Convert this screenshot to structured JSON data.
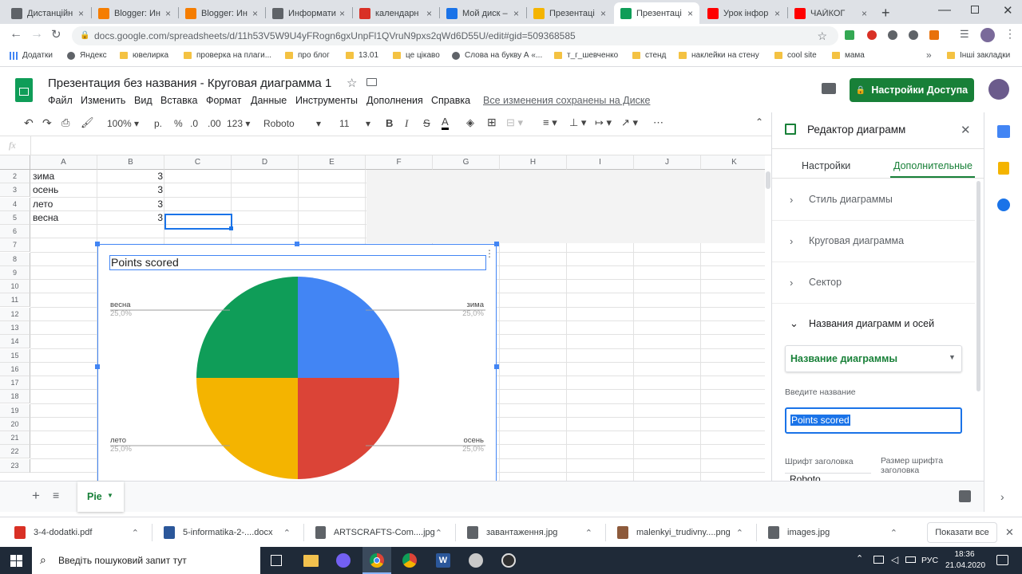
{
  "browser": {
    "tabs": [
      {
        "title": "Дистанційн",
        "fav": "globe-icon",
        "color": "#5f6368"
      },
      {
        "title": "Blogger: Ин",
        "fav": "blogger-icon",
        "color": "#f57d00"
      },
      {
        "title": "Blogger: Ин",
        "fav": "blogger-icon",
        "color": "#f57d00"
      },
      {
        "title": "Информати",
        "fav": "puzzle-icon",
        "color": "#5f6368"
      },
      {
        "title": "календарн",
        "fav": "gmail-icon",
        "color": "#d93025"
      },
      {
        "title": "Мой диск –",
        "fav": "drive-icon",
        "color": "#1a73e8"
      },
      {
        "title": "Презентаці",
        "fav": "slides-icon",
        "color": "#f4b400"
      },
      {
        "title": "Презентаці",
        "fav": "sheets-icon",
        "color": "#0f9d58"
      },
      {
        "title": "Урок інфор",
        "fav": "youtube-icon",
        "color": "#ff0000"
      },
      {
        "title": "ЧАЙКОГ",
        "fav": "youtube-icon",
        "color": "#ff0000"
      }
    ],
    "url": "docs.google.com/spreadsheets/d/11h53V5W9U4yFRogn6gxUnpFl1QVruN9pxs2qWd6D55U/edit#gid=509368585",
    "bookmarks": [
      {
        "label": "Додатки",
        "type": "apps"
      },
      {
        "label": "Яндекс",
        "type": "site"
      },
      {
        "label": "ювелирка",
        "type": "folder"
      },
      {
        "label": "проверка на плаги...",
        "type": "folder"
      },
      {
        "label": "про блог",
        "type": "folder"
      },
      {
        "label": "13.01",
        "type": "folder"
      },
      {
        "label": "це цікаво",
        "type": "folder"
      },
      {
        "label": "Слова на букву А «...",
        "type": "site"
      },
      {
        "label": "т_г_шевченко",
        "type": "folder"
      },
      {
        "label": "стенд",
        "type": "folder"
      },
      {
        "label": "наклейки на стену",
        "type": "folder"
      },
      {
        "label": "cool site",
        "type": "folder"
      },
      {
        "label": "мама",
        "type": "folder"
      }
    ],
    "more_bookmarks": "»",
    "other_bookmarks": "Інші закладки"
  },
  "app": {
    "title": "Презентация без названия - Круговая диаграмма 1",
    "menu": [
      "Файл",
      "Изменить",
      "Вид",
      "Вставка",
      "Формат",
      "Данные",
      "Инструменты",
      "Дополнения",
      "Справка"
    ],
    "saved_status": "Все изменения сохранены на Диске",
    "share_label": "Настройки Доступа"
  },
  "toolbar": {
    "zoom": "100%",
    "currency": "р.",
    "percent": "%",
    "dec_less": ".0",
    "dec_more": ".00",
    "format": "123",
    "font": "Roboto",
    "size": "11"
  },
  "formula": {
    "label": "fx",
    "value": ""
  },
  "sheet": {
    "columns": [
      "A",
      "B",
      "C",
      "D",
      "E",
      "F",
      "G",
      "H",
      "I",
      "J",
      "K"
    ],
    "rows": [
      "2",
      "3",
      "4",
      "5",
      "6",
      "7",
      "8",
      "9",
      "10",
      "11",
      "12",
      "13",
      "14",
      "15",
      "16",
      "17",
      "18",
      "19",
      "20",
      "21",
      "22",
      "23"
    ],
    "cells": [
      {
        "row": "2",
        "a": "зима",
        "b": "3"
      },
      {
        "row": "3",
        "a": "осень",
        "b": "3"
      },
      {
        "row": "4",
        "a": "лето",
        "b": "3"
      },
      {
        "row": "5",
        "a": "весна",
        "b": "3"
      }
    ]
  },
  "chart": {
    "title": "Points scored",
    "labels": [
      {
        "name": "весна",
        "pct": "25,0%"
      },
      {
        "name": "зима",
        "pct": "25,0%"
      },
      {
        "name": "лето",
        "pct": "25,0%"
      },
      {
        "name": "осень",
        "pct": "25,0%"
      }
    ]
  },
  "chart_data": {
    "type": "pie",
    "title": "Points scored",
    "categories": [
      "зима",
      "осень",
      "лето",
      "весна"
    ],
    "values": [
      3,
      3,
      3,
      3
    ],
    "percentages": [
      25.0,
      25.0,
      25.0,
      25.0
    ],
    "colors": [
      "#4285f4",
      "#db4437",
      "#f4b400",
      "#0f9d58"
    ]
  },
  "panel": {
    "title": "Редактор диаграмм",
    "tabs": [
      "Настройки",
      "Дополнительные"
    ],
    "sections": [
      "Стиль диаграммы",
      "Круговая диаграмма",
      "Сектор",
      "Названия диаграмм и осей"
    ],
    "dropdown": "Название диаграммы",
    "input_label": "Введите название",
    "input_value": "Points scored",
    "font_label": "Шрифт заголовка",
    "font_value": "Roboto",
    "size_label": "Размер шрифта заголовка"
  },
  "sheet_tab": "Pie",
  "downloads": [
    {
      "name": "3-4-dodatki.pdf",
      "type": "pdf",
      "color": "#d93025"
    },
    {
      "name": "5-informatika-2-....docx",
      "type": "docx",
      "color": "#2b579a"
    },
    {
      "name": "ARTSCRAFTS-Com....jpg",
      "type": "jpg",
      "color": "#5f6368"
    },
    {
      "name": "завантаження.jpg",
      "type": "jpg",
      "color": "#5f6368"
    },
    {
      "name": "malenkyi_trudivny....png",
      "type": "png",
      "color": "#8d5a3b"
    },
    {
      "name": "images.jpg",
      "type": "jpg",
      "color": "#5f6368"
    }
  ],
  "show_all": "Показати все",
  "taskbar": {
    "search_placeholder": "Введіть пошуковий запит тут",
    "lang": "РУС",
    "time": "18:36",
    "date": "21.04.2020"
  }
}
